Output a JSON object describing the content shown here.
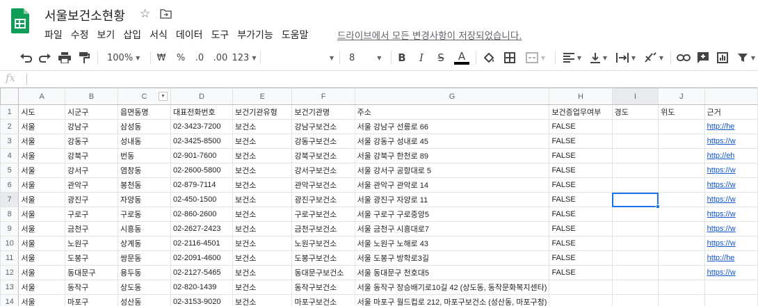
{
  "doc": {
    "title": "서울보건소현황",
    "save_status": "드라이브에서 모든 변경사항이 저장되었습니다."
  },
  "menus": [
    "파일",
    "수정",
    "보기",
    "삽입",
    "서식",
    "데이터",
    "도구",
    "부가기능",
    "도움말"
  ],
  "toolbar": {
    "zoom": "100%",
    "currency": "₩",
    "percent": "%",
    "decrease_decimal": ".0",
    "increase_decimal": ".00",
    "number_format": "123",
    "font_size": "8",
    "bold": "B",
    "italic": "I",
    "strikethrough": "S",
    "text_color_letter": "A",
    "text_color": "#000000"
  },
  "formula_bar": {
    "fx": "fx",
    "value": ""
  },
  "grid": {
    "columns": [
      "A",
      "B",
      "C",
      "D",
      "E",
      "F",
      "G",
      "H",
      "I",
      "J",
      ""
    ],
    "rows": [
      {
        "n": "1",
        "cells": [
          "시도",
          "시군구",
          "읍면동명",
          "대표전화번호",
          "보건기관유형",
          "보건기관명",
          "주소",
          "보건증업무여부",
          "경도",
          "위도",
          "근거"
        ]
      },
      {
        "n": "2",
        "cells": [
          "서울",
          "강남구",
          "삼성동",
          "02-3423-7200",
          "보건소",
          "강남구보건소",
          "서울 강남구 선릉로 66",
          "FALSE",
          "",
          "",
          "http://he"
        ]
      },
      {
        "n": "3",
        "cells": [
          "서울",
          "강동구",
          "성내동",
          "02-3425-8500",
          "보건소",
          "강동구보건소",
          "서울 강동구 성내로 45",
          "FALSE",
          "",
          "",
          "https://w"
        ]
      },
      {
        "n": "4",
        "cells": [
          "서울",
          "강북구",
          "번동",
          "02-901-7600",
          "보건소",
          "강북구보건소",
          "서울 강북구 한천로 89",
          "FALSE",
          "",
          "",
          "http://eh"
        ]
      },
      {
        "n": "5",
        "cells": [
          "서울",
          "강서구",
          "염창동",
          "02-2600-5800",
          "보건소",
          "강서구보건소",
          "서울 강서구 공항대로 5",
          "FALSE",
          "",
          "",
          "https://w"
        ]
      },
      {
        "n": "6",
        "cells": [
          "서울",
          "관악구",
          "봉천동",
          "02-879-7114",
          "보건소",
          "관악구보건소",
          "서울 관악구 관악로 14",
          "FALSE",
          "",
          "",
          "https://w"
        ]
      },
      {
        "n": "7",
        "cells": [
          "서울",
          "광진구",
          "자양동",
          "02-450-1500",
          "보건소",
          "광진구보건소",
          "서울 광진구 자양로 11",
          "FALSE",
          "",
          "",
          "https://w"
        ]
      },
      {
        "n": "8",
        "cells": [
          "서울",
          "구로구",
          "구로동",
          "02-860-2600",
          "보건소",
          "구로구보건소",
          "서울 구로구 구로중앙5",
          "FALSE",
          "",
          "",
          "https://w"
        ]
      },
      {
        "n": "9",
        "cells": [
          "서울",
          "금천구",
          "시흥동",
          "02-2627-2423",
          "보건소",
          "금천구보건소",
          "서울 금천구 시흥대로7",
          "FALSE",
          "",
          "",
          "https://w"
        ]
      },
      {
        "n": "10",
        "cells": [
          "서울",
          "노원구",
          "상계동",
          "02-2116-4501",
          "보건소",
          "노원구보건소",
          "서울 노원구 노해로 43",
          "FALSE",
          "",
          "",
          "https://w"
        ]
      },
      {
        "n": "11",
        "cells": [
          "서울",
          "도봉구",
          "쌍문동",
          "02-2091-4600",
          "보건소",
          "도봉구보건소",
          "서울 도봉구 방학로3길",
          "FALSE",
          "",
          "",
          "http://he"
        ]
      },
      {
        "n": "12",
        "cells": [
          "서울",
          "동대문구",
          "용두동",
          "02-2127-5465",
          "보건소",
          "동대문구보건소",
          "서울 동대문구 천호대5",
          "FALSE",
          "",
          "",
          "https://w"
        ]
      },
      {
        "n": "13",
        "cells": [
          "서울",
          "동작구",
          "상도동",
          "02-820-1439",
          "보건소",
          "동작구보건소",
          "서울 동작구 장승배기로10길 42 (상도동, 동작문화복지센타)",
          "",
          "",
          "",
          ""
        ]
      },
      {
        "n": "14",
        "cells": [
          "서울",
          "마포구",
          "성산동",
          "02-3153-9020",
          "보건소",
          "마포구보건소",
          "서울 마포구 월드컵로 212, 마포구보건소 (성산동, 마포구청)",
          "",
          "",
          "",
          ""
        ]
      }
    ],
    "active_cell": "I7",
    "filter_column": "C"
  }
}
